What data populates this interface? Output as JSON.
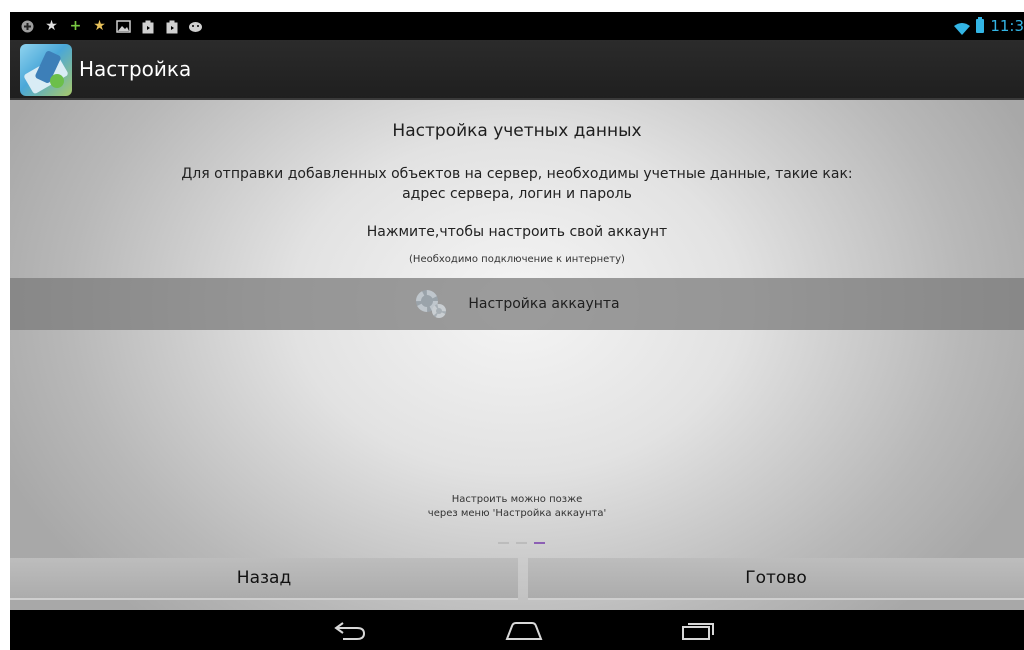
{
  "status_bar": {
    "icons": [
      "notification-icon",
      "star-icon",
      "plus-icon",
      "star-icon",
      "image-icon",
      "play-store-icon",
      "play-store-icon",
      "android-icon"
    ],
    "time": "11:3",
    "accent_color": "#33b5e5"
  },
  "action_bar": {
    "title": "Настройка"
  },
  "content": {
    "heading": "Настройка учетных данных",
    "description": "Для отправки добавленных объектов на сервер, необходимы учетные данные, такие как: адрес сервера, логин и пароль",
    "press_text": "Нажмите,чтобы настроить свой аккаунт",
    "note": "(Необходимо подключение к интернету)",
    "account_button_label": "Настройка аккаунта",
    "later_line1": "Настроить можно позже",
    "later_line2": "через меню 'Настройка аккаунта'",
    "page_indicator": {
      "count": 3,
      "active": 3,
      "active_color": "#8c5fb4"
    }
  },
  "buttons": {
    "back": "Назад",
    "done": "Готово"
  },
  "nav_bar": {
    "icons": [
      "back-icon",
      "home-icon",
      "recent-apps-icon"
    ]
  }
}
